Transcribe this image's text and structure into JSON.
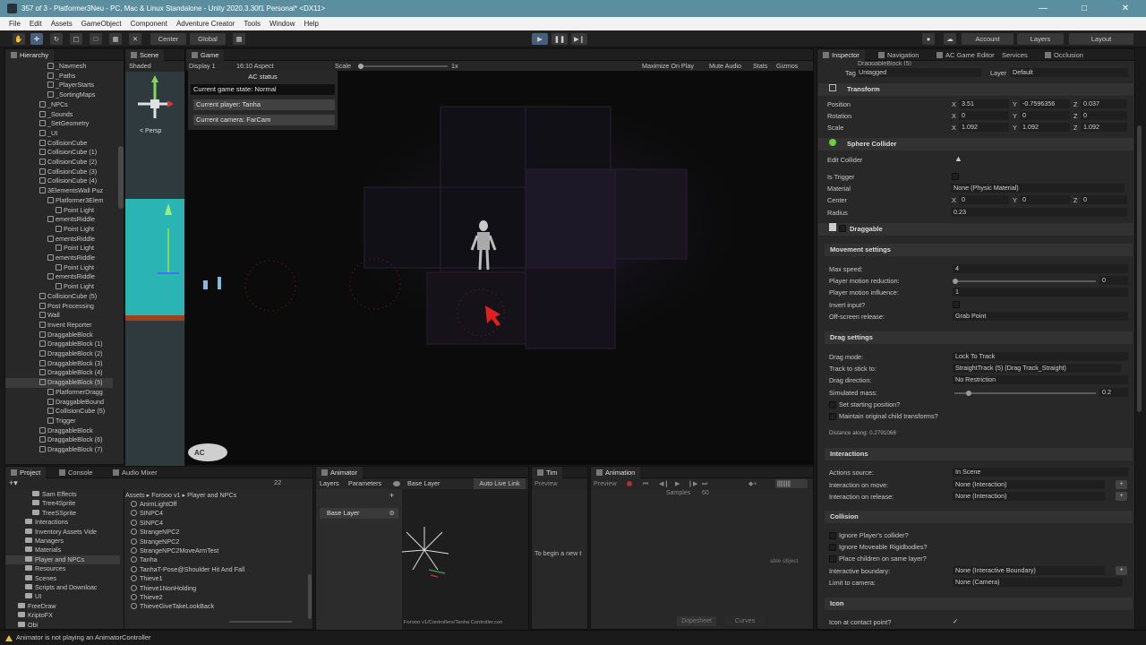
{
  "window": {
    "title": "357 of 3 - Platformer3Neu - PC, Mac & Linux Standalone - Unity 2020.3.30f1 Personal* <DX11>",
    "controls": [
      "—",
      "□",
      "✕"
    ]
  },
  "menubar": [
    "File",
    "Edit",
    "Assets",
    "GameObject",
    "Component",
    "Adventure Creator",
    "Tools",
    "Window",
    "Help"
  ],
  "toolbar": {
    "pivot": "Center",
    "space": "Global",
    "account": "Account",
    "layers": "Layers",
    "layout": "Layout"
  },
  "hierarchy": {
    "tab": "Hierarchy",
    "items": [
      "_Navmesh",
      "_Paths",
      "_PlayerStarts",
      "_SortingMaps",
      "_NPCs",
      "_Sounds",
      "_SetGeometry",
      "_UI",
      "CollisionCube",
      "CollisionCube (1)",
      "CollisionCube (2)",
      "CollisionCube (3)",
      "CollisionCube (4)",
      "3ElementsWall Puz",
      "Platformer3Elem",
      "Point Light",
      "ementsRiddle",
      "Point Light",
      "ementsRiddle",
      "Point Light",
      "ementsRiddle",
      "Point Light",
      "ementsRiddle",
      "Point Light",
      "CollisionCube (5)",
      "Post Processing",
      "Wall",
      "Invent Reporter",
      "DraggableBlock",
      "DraggableBlock (1)",
      "DraggableBlock (2)",
      "DraggableBlock (3)",
      "DraggableBlock (4)",
      "DraggableBlock (5)",
      "PlatformerDragg",
      "DraggableBound",
      "CollisionCube (5)",
      "Trigger",
      "DraggableBlock",
      "DraggableBlock (6)",
      "DraggableBlock (7)"
    ]
  },
  "scene": {
    "tab": "Scene",
    "mode": "Shaded",
    "persp": "< Persp"
  },
  "game": {
    "tab": "Game",
    "display": "Display 1",
    "aspect": "16:10 Aspect",
    "scale_label": "Scale",
    "scale_value": "1x",
    "options": [
      "Maximize On Play",
      "Mute Audio",
      "Stats",
      "Gizmos"
    ],
    "ac_status": {
      "title": "AC status",
      "game_state": "Current game state: Normal",
      "player": "Current player: Tanha",
      "camera": "Current camera: FarCam"
    }
  },
  "inspector": {
    "tabs": [
      "Inspector",
      "Navigation",
      "AC Game Editor",
      "Services",
      "Occlusion"
    ],
    "header_name": "DraggableBlock (5)",
    "tag_label": "Tag",
    "tag_value": "Untagged",
    "layer_label": "Layer",
    "layer_value": "Default",
    "transform": {
      "title": "Transform",
      "rows": [
        {
          "label": "Position",
          "x": "3.51",
          "y": "-0.7596356",
          "z": "0.037"
        },
        {
          "label": "Rotation",
          "x": "0",
          "y": "0",
          "z": "0"
        },
        {
          "label": "Scale",
          "x": "1.092",
          "y": "1.092",
          "z": "1.092"
        }
      ]
    },
    "sphere_collider": {
      "title": "Sphere Collider",
      "edit_collider": "Edit Collider",
      "is_trigger": "Is Trigger",
      "material_label": "Material",
      "material_value": "None (Physic Material)",
      "center_label": "Center",
      "center": {
        "x": "0",
        "y": "0",
        "z": "0"
      },
      "radius_label": "Radius",
      "radius_value": "0.23"
    },
    "draggable": {
      "title": "Draggable",
      "movement_title": "Movement settings",
      "max_speed_label": "Max speed:",
      "max_speed_value": "4",
      "motion_reduction_label": "Player motion reduction:",
      "motion_reduction_value": "0",
      "motion_influence_label": "Player motion influence:",
      "motion_influence_value": "1",
      "invert_input_label": "Invert input?",
      "offscreen_label": "Off-screen release:",
      "offscreen_value": "Grab Point",
      "drag_title": "Drag settings",
      "drag_mode_label": "Drag mode:",
      "drag_mode_value": "Lock To Track",
      "track_label": "Track to stick to:",
      "track_value": "StraightTrack (5) (Drag Track_Straight)",
      "direction_label": "Drag direction:",
      "direction_value": "No Restriction",
      "simulated_mass_label": "Simulated mass:",
      "simulated_mass_value": "0.2",
      "set_start_label": "Set starting position?",
      "maintain_label": "Maintain original child transforms?",
      "distance_label": "Distance along: 0.2791068",
      "interactions_title": "Interactions",
      "actions_source_label": "Actions source:",
      "actions_source_value": "In Scene",
      "on_move_label": "Interaction on move:",
      "on_move_value": "None (Interaction)",
      "on_release_label": "Interaction on release:",
      "on_release_value": "None (Interaction)",
      "collision_title": "Collision",
      "ignore_player_label": "Ignore Player's collider?",
      "ignore_rigid_label": "Ignore Moveable Rigidbodies?",
      "place_children_label": "Place children on same layer?",
      "boundary_label": "Interactive boundary:",
      "boundary_value": "None (Interactive Boundary)",
      "limit_label": "Limit to camera:",
      "limit_value": "None (Camera)",
      "icon_title": "Icon",
      "icon_contact_label": "Icon at contact point?"
    }
  },
  "project": {
    "tabs": [
      "Project",
      "Console",
      "Audio Mixer"
    ],
    "count": "22",
    "folders": [
      "Sam Effects",
      "Tree4Sprite",
      "TreeSSprite",
      "Interactions",
      "Inventory Assets Vide",
      "Managers",
      "Materials",
      "Player and NPCs",
      "Resources",
      "Scenes",
      "Scripts and Downloac",
      "UI",
      "FreeDraw",
      "KriptoFX",
      "Obi"
    ],
    "breadcrumb": [
      "Assets",
      "Forooo v1",
      "Player and NPCs"
    ],
    "files": [
      "AnimLightOff",
      "SINPC4",
      "SINPC4",
      "StrangeNPC2",
      "StrangeNPC2",
      "StrangeNPC2MoveArmTest",
      "Tanha",
      "TanhaT-Pose@Shoulder Hit And Fall",
      "Thieve1",
      "Thieve1NonHolding",
      "Thieve2",
      "ThieveGiveTakeLookBack"
    ]
  },
  "animator": {
    "tab": "Animator",
    "subtabs": [
      "Layers",
      "Parameters"
    ],
    "breadcrumb": "Base Layer",
    "auto_live_link": "Auto Live Link",
    "layer_item": "Base Layer",
    "footer_path": "Forooo v1/Controllers/Tanha Controller.con"
  },
  "timeline": {
    "tab": "Tim",
    "preview": "Preview",
    "message": "To begin a new t"
  },
  "animation": {
    "tab": "Animation",
    "preview": "Preview",
    "samples_label": "Samples",
    "samples_value": "60",
    "right_note": "able object",
    "dopesheet": "Dopesheet",
    "curves": "Curves"
  },
  "status": {
    "message": "Animator is not playing an AnimatorController"
  },
  "colors": {
    "titlebar": "#5b8fa0",
    "play_active": "#46607c",
    "editor_bg": "#282828",
    "game_bg": "#0b0b0b",
    "purple_glow": "#3a2a55",
    "red_cursor": "#e02020"
  }
}
